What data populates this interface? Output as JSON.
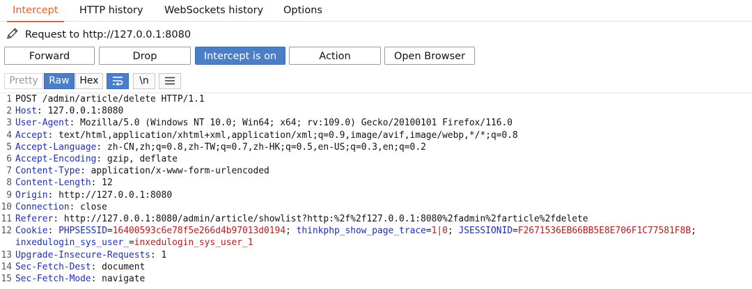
{
  "tabs": [
    "Intercept",
    "HTTP history",
    "WebSockets history",
    "Options"
  ],
  "request_line": "Request to http://127.0.0.1:8080",
  "buttons": {
    "forward": "Forward",
    "drop": "Drop",
    "intercept": "Intercept is on",
    "action": "Action",
    "open_browser": "Open Browser"
  },
  "toolbar": {
    "pretty": "Pretty",
    "raw": "Raw",
    "hex": "Hex",
    "newline": "\\n"
  },
  "colors": {
    "accent": "#e8612c",
    "toggle_on": "#4a7ec9",
    "header_name": "#1c2fb0",
    "cookie_value": "#b01c1c"
  },
  "lines": [
    {
      "n": "1",
      "text": "POST /admin/article/delete HTTP/1.1"
    },
    {
      "n": "2",
      "key": "Host",
      "val": " 127.0.0.1:8080"
    },
    {
      "n": "3",
      "key": "User-Agent",
      "val": " Mozilla/5.0 (Windows NT 10.0; Win64; x64; rv:109.0) Gecko/20100101 Firefox/116.0"
    },
    {
      "n": "4",
      "key": "Accept",
      "val": " text/html,application/xhtml+xml,application/xml;q=0.9,image/avif,image/webp,*/*;q=0.8"
    },
    {
      "n": "5",
      "key": "Accept-Language",
      "val": " zh-CN,zh;q=0.8,zh-TW;q=0.7,zh-HK;q=0.5,en-US;q=0.3,en;q=0.2"
    },
    {
      "n": "6",
      "key": "Accept-Encoding",
      "val": " gzip, deflate"
    },
    {
      "n": "7",
      "key": "Content-Type",
      "val": " application/x-www-form-urlencoded"
    },
    {
      "n": "8",
      "key": "Content-Length",
      "val": " 12"
    },
    {
      "n": "9",
      "key": "Origin",
      "val": " http://127.0.0.1:8080"
    },
    {
      "n": "10",
      "key": "Connection",
      "val": " close"
    },
    {
      "n": "11",
      "key": "Referer",
      "val": " http://127.0.0.1:8080/admin/article/showlist?http:%2f%2f127.0.0.1:8080%2fadmin%2farticle%2fdelete"
    },
    {
      "n": "13",
      "key": "Upgrade-Insecure-Requests",
      "val": " 1"
    },
    {
      "n": "14",
      "key": "Sec-Fetch-Dest",
      "val": " document"
    },
    {
      "n": "15",
      "key": "Sec-Fetch-Mode",
      "val": " navigate"
    }
  ],
  "cookie": {
    "n": "12",
    "key": "Cookie",
    "pairs": [
      {
        "name": "PHPSESSID",
        "value": "16400593c6e78f5e266d4b97013d0194"
      },
      {
        "name": "thinkphp_show_page_trace",
        "value": "1|0"
      },
      {
        "name": "JSESSIONID",
        "value": "F2671536EB66BB5E8E706F1C77581F8B"
      },
      {
        "name": "inxedulogin_sys_user_",
        "value": "inxedulogin_sys_user_1"
      }
    ]
  }
}
